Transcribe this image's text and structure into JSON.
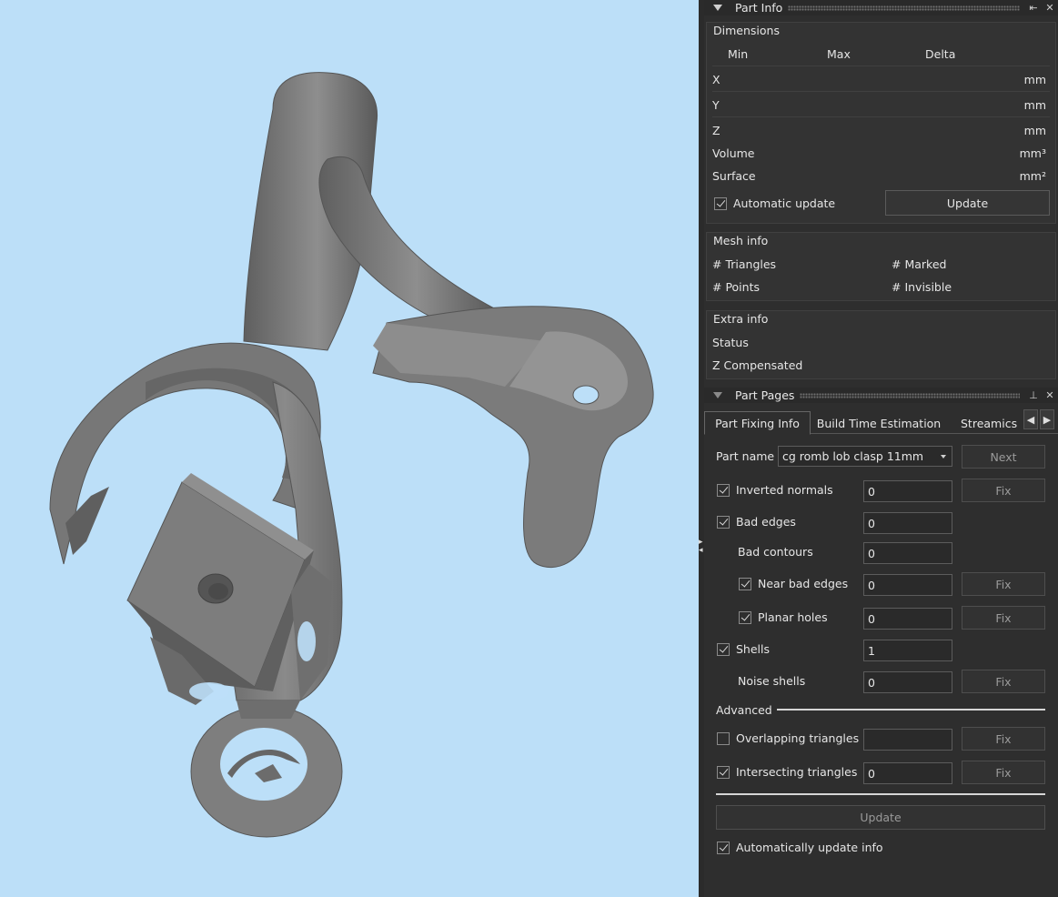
{
  "part_info": {
    "title": "Part Info",
    "dimensions": {
      "title": "Dimensions",
      "headers": [
        "Min",
        "Max",
        "Delta"
      ],
      "rows": [
        {
          "label": "X",
          "unit": "mm"
        },
        {
          "label": "Y",
          "unit": "mm"
        },
        {
          "label": "Z",
          "unit": "mm"
        }
      ],
      "volume_label": "Volume",
      "volume_unit": "mm³",
      "surface_label": "Surface",
      "surface_unit": "mm²",
      "auto_update_label": "Automatic update",
      "auto_update_checked": true,
      "update_button": "Update"
    },
    "mesh_info": {
      "title": "Mesh info",
      "triangles": "# Triangles",
      "marked": "# Marked",
      "points": "# Points",
      "invisible": "# Invisible"
    },
    "extra_info": {
      "title": "Extra info",
      "status": "Status",
      "z_compensated": "Z Compensated"
    }
  },
  "part_pages": {
    "title": "Part Pages",
    "tabs": [
      "Part Fixing Info",
      "Build Time Estimation",
      "Streamics P"
    ],
    "active_tab": 0,
    "part_name_label": "Part name",
    "part_name_value": "cg romb lob clasp 11mm",
    "next_button": "Next",
    "fix_label": "Fix",
    "checks": {
      "inverted_normals": {
        "label": "Inverted normals",
        "checked": true,
        "value": "0"
      },
      "bad_edges": {
        "label": "Bad edges",
        "checked": true,
        "value": "0"
      },
      "bad_contours": {
        "label": "Bad contours",
        "value": "0"
      },
      "near_bad_edges": {
        "label": "Near bad edges",
        "checked": true,
        "value": "0"
      },
      "planar_holes": {
        "label": "Planar holes",
        "checked": true,
        "value": "0"
      },
      "shells": {
        "label": "Shells",
        "checked": true,
        "value": "1"
      },
      "noise_shells": {
        "label": "Noise shells",
        "value": "0"
      },
      "overlapping_triangles": {
        "label": "Overlapping triangles",
        "checked": false,
        "value": ""
      },
      "intersecting_triangles": {
        "label": "Intersecting triangles",
        "checked": true,
        "value": "0"
      }
    },
    "advanced_label": "Advanced",
    "update_button": "Update",
    "auto_update_label": "Automatically update info",
    "auto_update_checked": true
  },
  "icons": {
    "collapse": "triangle-down-icon",
    "float": "float-icon",
    "pin": "pin-icon",
    "close": "close-icon",
    "tab_left": "chevron-left-icon",
    "tab_right": "chevron-right-icon"
  },
  "colors": {
    "viewport_bg": "#bcdff8",
    "panel_bg": "#2e2e2e",
    "model_gray": "#7a7a7a"
  }
}
